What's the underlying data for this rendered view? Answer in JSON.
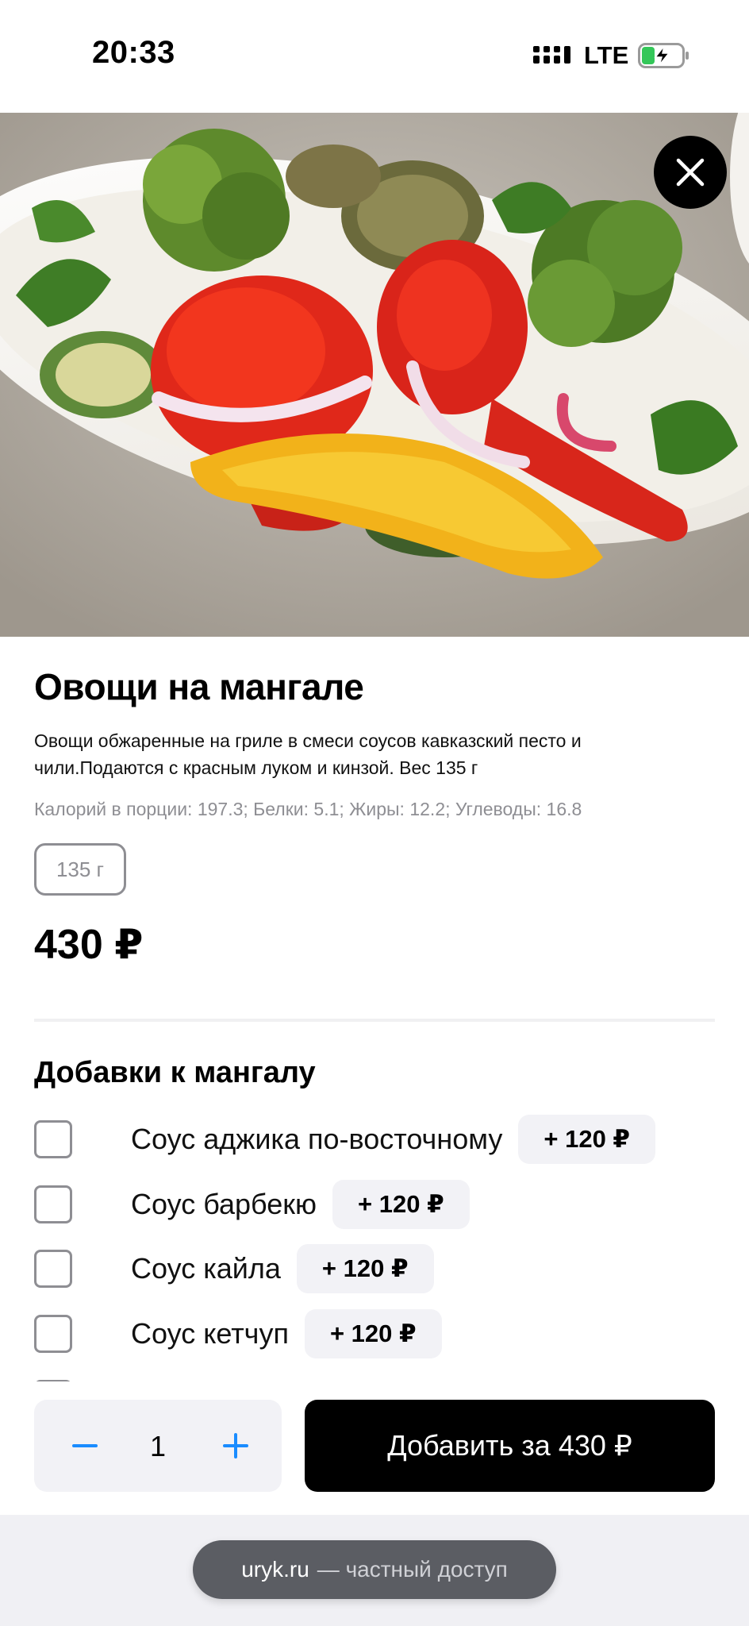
{
  "status_bar": {
    "time": "20:33",
    "network": "LTE",
    "signal_icon": "signal-bars-icon",
    "battery_icon": "battery-charging-icon"
  },
  "hero": {
    "close_icon": "close-icon"
  },
  "dish": {
    "title": "Овощи на мангале",
    "description": "Овощи обжаренные на гриле в смеси соусов кавказский песто и чили.Подаются с красным луком и кинзой. Вес 135 г",
    "nutrition": "Калорий в порции: 197.3; Белки: 5.1; Жиры: 12.2; Углеводы: 16.8",
    "weight_option": "135 г",
    "price": "430 ₽"
  },
  "addons": {
    "title": "Добавки к мангалу",
    "items": [
      {
        "name": "Соус аджика по-восточному",
        "price": "+ 120 ₽",
        "checked": false
      },
      {
        "name": "Соус барбекю",
        "price": "+ 120 ₽",
        "checked": false
      },
      {
        "name": "Соус кайла",
        "price": "+ 120 ₽",
        "checked": false
      },
      {
        "name": "Соус кетчуп",
        "price": "+ 120 ₽",
        "checked": false
      }
    ]
  },
  "cart": {
    "quantity": "1",
    "add_button_label": "Добавить за 430 ₽"
  },
  "browser": {
    "domain": "uryk.ru",
    "note": "— частный доступ"
  },
  "colors": {
    "accent": "#1a8cff",
    "chip_bg": "#f2f2f6",
    "muted_text": "#8e8e93",
    "button_bg": "#000000"
  }
}
